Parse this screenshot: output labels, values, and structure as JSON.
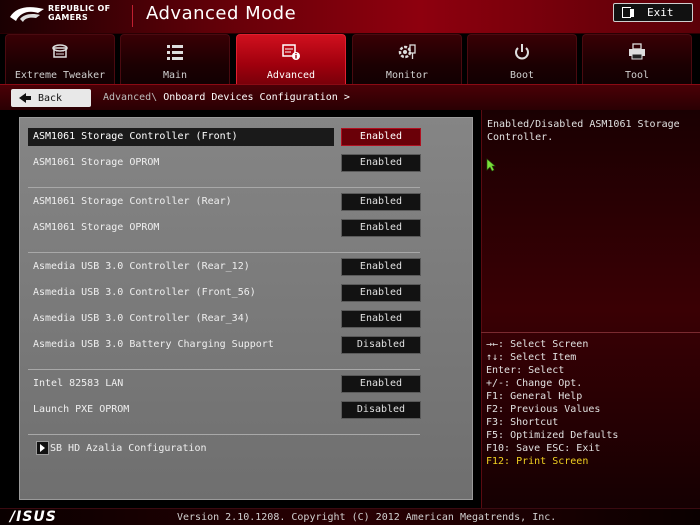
{
  "header": {
    "brand_line1": "REPUBLIC OF",
    "brand_line2": "GAMERS",
    "mode_title": "Advanced Mode",
    "exit_label": "Exit"
  },
  "tabs": [
    {
      "label": "Extreme Tweaker",
      "icon": "tweaker-icon",
      "active": false
    },
    {
      "label": "Main",
      "icon": "list-icon",
      "active": false
    },
    {
      "label": "Advanced",
      "icon": "advanced-info-icon",
      "active": true
    },
    {
      "label": "Monitor",
      "icon": "monitor-gear-icon",
      "active": false
    },
    {
      "label": "Boot",
      "icon": "power-icon",
      "active": false
    },
    {
      "label": "Tool",
      "icon": "printer-tool-icon",
      "active": false
    }
  ],
  "breadcrumb": {
    "back_label": "Back",
    "parent": "Advanced",
    "separator": "\\",
    "current": " Onboard Devices Configuration",
    "chevron": ">"
  },
  "settings": [
    {
      "label": "ASM1061 Storage Controller (Front)",
      "value": "Enabled",
      "selected": true
    },
    {
      "label": "ASM1061 Storage OPROM",
      "value": "Enabled"
    },
    {
      "label": "ASM1061 Storage Controller (Rear)",
      "value": "Enabled"
    },
    {
      "label": "ASM1061 Storage OPROM",
      "value": "Enabled"
    },
    {
      "label": "Asmedia USB 3.0 Controller (Rear_12)",
      "value": "Enabled"
    },
    {
      "label": "Asmedia USB 3.0 Controller (Front_56)",
      "value": "Enabled"
    },
    {
      "label": "Asmedia USB 3.0 Controller (Rear_34)",
      "value": "Enabled"
    },
    {
      "label": "Asmedia USB 3.0 Battery Charging Support",
      "value": "Disabled"
    },
    {
      "label": "Intel 82583 LAN",
      "value": "Enabled"
    },
    {
      "label": "Launch PXE OPROM",
      "value": "Disabled"
    }
  ],
  "submenu": {
    "label": "SB HD Azalia Configuration"
  },
  "help": {
    "description": "Enabled/Disabled ASM1061 Storage Controller."
  },
  "keys": [
    "→←: Select Screen",
    "↑↓: Select Item",
    "Enter: Select",
    "+/-: Change Opt.",
    "F1: General Help",
    "F2: Previous Values",
    "F3: Shortcut",
    "F5: Optimized Defaults",
    "F10: Save  ESC: Exit",
    "F12: Print Screen"
  ],
  "footer": {
    "brand": "/ISUS",
    "version": "Version 2.10.1208. Copyright (C) 2012 American Megatrends, Inc."
  },
  "colors": {
    "accent_red": "#c0101e",
    "active_value": "#6a0008",
    "panel_gray": "#7a7a7a",
    "key_highlight": "#f0d020"
  }
}
